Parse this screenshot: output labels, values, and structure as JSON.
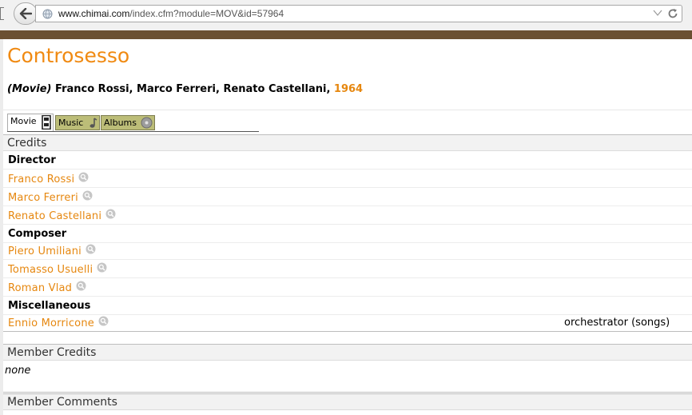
{
  "browser": {
    "url_host": "www.chimai.com",
    "url_path": "/index.cfm?module=MOV&id=57964"
  },
  "page": {
    "title": "Controsesso",
    "type_label": "(Movie)",
    "directors_line": "Franco Rossi, Marco Ferreri, Renato Castellani,",
    "year": "1964"
  },
  "tabs": [
    {
      "label": "Movie",
      "icon": "film-icon",
      "active": true
    },
    {
      "label": "Music",
      "icon": "music-note-icon",
      "active": false
    },
    {
      "label": "Albums",
      "icon": "disc-icon",
      "active": false
    }
  ],
  "credits": {
    "heading": "Credits",
    "groups": [
      {
        "role": "Director",
        "people": [
          {
            "name": "Franco Rossi",
            "note": ""
          },
          {
            "name": "Marco Ferreri",
            "note": ""
          },
          {
            "name": "Renato Castellani",
            "note": ""
          }
        ]
      },
      {
        "role": "Composer",
        "people": [
          {
            "name": "Piero Umiliani",
            "note": ""
          },
          {
            "name": "Tomasso Usuelli",
            "note": ""
          },
          {
            "name": "Roman Vlad",
            "note": ""
          }
        ]
      },
      {
        "role": "Miscellaneous",
        "people": [
          {
            "name": "Ennio Morricone",
            "note": "orchestrator (songs)"
          }
        ]
      }
    ]
  },
  "member_credits": {
    "heading": "Member Credits",
    "value": "none"
  },
  "member_comments": {
    "heading": "Member Comments"
  },
  "colors": {
    "accent": "#f08a12",
    "link": "#e6870f",
    "band": "#6b5032",
    "tab_bg": "#bcbd78"
  }
}
